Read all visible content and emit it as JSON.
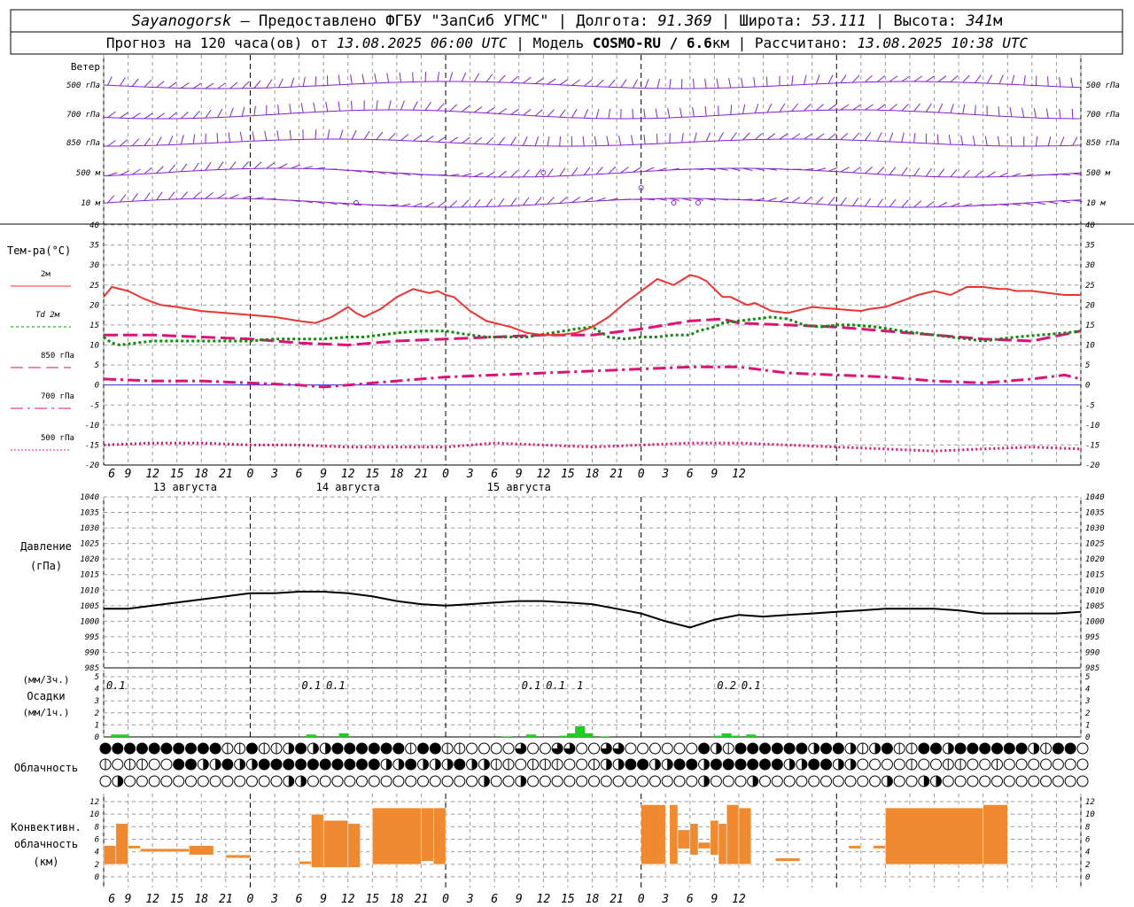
{
  "header": {
    "line1": {
      "station": "Sayanogorsk",
      "provider": " — Предоставлено ФГБУ \"ЗапСиб УГМС\" | Долгота: ",
      "lon": "91.369",
      "lat_label": " | Широта: ",
      "lat": "53.111",
      "alt_label": " | Высота: ",
      "alt": "341",
      "alt_unit": "м"
    },
    "line2": {
      "prefix": "Прогноз на 120 часа(ов) от ",
      "run": "13.08.2025 06:00 UTC",
      "model_label": "  | Модель ",
      "model": "COSMO-RU / 6.6",
      "model_unit": "км",
      "calc_label": " | Рассчитано: ",
      "calc": "13.08.2025 10:38 UTC"
    }
  },
  "colors": {
    "t2m": "#ee3333",
    "td2m": "#118811",
    "t850": "#dd1177",
    "t700": "#dd1177",
    "t500": "#dd1177",
    "zero_line": "#3333cc",
    "wind": "#8822cc",
    "pressure": "#000000",
    "precip": "#22cc22",
    "convective": "#f08a30",
    "grid": "#999999"
  },
  "x_axis": {
    "hour_ticks": [
      "6",
      "9",
      "12",
      "15",
      "18",
      "21",
      "0",
      "3",
      "6",
      "9",
      "12",
      "15",
      "18",
      "21",
      "0",
      "3",
      "6",
      "9",
      "12",
      "15",
      "18",
      "21",
      "0",
      "3",
      "6",
      "9",
      "12"
    ],
    "dates": [
      "13 августа",
      "14 августа",
      "15 августа"
    ]
  },
  "wind_panel": {
    "title": "Ветер",
    "levels_left": [
      "500 гПа",
      "700 гПа",
      "850 гПа",
      "500 м",
      "10 м"
    ],
    "levels_right": [
      "500 гПа",
      "700 гПа",
      "850 гПа",
      "500 м",
      "10 м"
    ]
  },
  "temp_panel": {
    "title": "Тем-ра(°C)",
    "legend": [
      {
        "label": "2м",
        "style": "solid",
        "key": "t2m"
      },
      {
        "label": "Td 2м",
        "style": "dotted",
        "key": "td2m"
      },
      {
        "label": "850 гПа",
        "style": "dashed",
        "key": "t850"
      },
      {
        "label": "700 гПа",
        "style": "dashdot",
        "key": "t700"
      },
      {
        "label": "500 гПа",
        "style": "dotted",
        "key": "t500"
      }
    ],
    "yticks": [
      "40",
      "35",
      "30",
      "25",
      "20",
      "15",
      "10",
      "5",
      "0",
      "-5",
      "-10",
      "-15",
      "-20"
    ]
  },
  "pressure_panel": {
    "title": "Давление",
    "unit": "(гПа)",
    "yticks": [
      "1040",
      "1035",
      "1030",
      "1025",
      "1020",
      "1015",
      "1010",
      "1005",
      "1000",
      "995",
      "990",
      "985"
    ]
  },
  "precip_panel": {
    "title": "Осадки",
    "unit_3h": "(мм/3ч.)",
    "unit_1h": "(мм/1ч.)",
    "yticks": [
      "5",
      "4",
      "3",
      "2",
      "1",
      "0"
    ],
    "labels": [
      {
        "h": 1.5,
        "text": "0.1"
      },
      {
        "h": 25.5,
        "text": "0.1"
      },
      {
        "h": 28.5,
        "text": "0.1"
      },
      {
        "h": 52.5,
        "text": "0.1"
      },
      {
        "h": 55.5,
        "text": "0.1"
      },
      {
        "h": 58.5,
        "text": "1"
      },
      {
        "h": 76.5,
        "text": "0.2"
      },
      {
        "h": 79.5,
        "text": "0.1"
      }
    ]
  },
  "cloud_panel": {
    "title": "Облачность"
  },
  "conv_panel": {
    "title_1": "Конвективн.",
    "title_2": "облачность",
    "unit": "(км)",
    "yticks": [
      "12",
      "10",
      "8",
      "6",
      "4",
      "2",
      "0"
    ]
  },
  "chart_data": [
    {
      "type": "line",
      "title": "Тем-ра(°C)",
      "ylim": [
        -20,
        40
      ],
      "x_unit": "hours since 13.08.2025 06:00 UTC",
      "series": [
        {
          "name": "2м",
          "x": [
            0,
            1,
            3,
            5,
            7,
            9,
            12,
            15,
            18,
            21,
            24,
            26,
            28,
            30,
            31,
            32,
            34,
            36,
            38,
            40,
            41,
            42,
            43,
            45,
            47,
            50,
            52,
            54,
            56,
            58,
            60,
            62,
            64,
            67,
            68,
            70,
            72,
            73,
            74,
            75,
            76,
            77,
            79,
            80,
            82,
            84,
            87,
            90,
            93,
            94,
            96,
            98,
            100,
            102,
            104,
            106,
            108,
            110,
            111,
            112,
            114,
            116,
            118,
            120
          ],
          "y": [
            22,
            24.5,
            23.5,
            21.5,
            20,
            19.5,
            18.5,
            18,
            17.5,
            17,
            16,
            15.5,
            17,
            19.5,
            18,
            17,
            19,
            22,
            24,
            23,
            23.5,
            22.5,
            22,
            18.5,
            16,
            14.5,
            13,
            12.5,
            12.5,
            13,
            14.5,
            17,
            20.5,
            25,
            26.5,
            25,
            27.5,
            27,
            26,
            24,
            22,
            22,
            20,
            20.5,
            18.5,
            18,
            19.5,
            19,
            18.5,
            19,
            19.5,
            21,
            22.5,
            23.5,
            22.5,
            24.5,
            24.5,
            24,
            24,
            23.5,
            23.5,
            23,
            22.5,
            22.5
          ]
        },
        {
          "name": "Td 2м",
          "x": [
            0,
            1,
            2,
            4,
            6,
            9,
            12,
            15,
            18,
            21,
            24,
            27,
            30,
            32,
            34,
            36,
            39,
            42,
            45,
            47,
            48,
            50,
            52,
            55,
            58,
            60,
            62,
            64,
            66,
            68,
            70,
            72,
            73,
            74,
            75,
            76,
            78,
            80,
            82,
            84,
            86,
            88,
            90,
            92,
            95,
            98,
            100,
            102,
            104,
            106,
            108,
            110,
            112,
            115,
            118,
            120
          ],
          "y": [
            12,
            10.5,
            10,
            10.5,
            11,
            11,
            11,
            11,
            11,
            11.5,
            11.5,
            11.5,
            12,
            12,
            12.5,
            13,
            13.5,
            13.5,
            12.5,
            12,
            12,
            12,
            12,
            13,
            14,
            14.5,
            12,
            11.5,
            12,
            12,
            12.5,
            12.5,
            13.5,
            14,
            14.5,
            15.5,
            16,
            16.5,
            17,
            16.5,
            15,
            14.5,
            15,
            15,
            14.5,
            13.5,
            13,
            12.5,
            12,
            11.5,
            11,
            11.5,
            12,
            12.5,
            13,
            13.5
          ]
        },
        {
          "name": "850 гПа",
          "x": [
            0,
            6,
            12,
            18,
            24,
            30,
            36,
            42,
            48,
            54,
            60,
            66,
            72,
            76,
            78,
            84,
            90,
            96,
            102,
            108,
            114,
            120
          ],
          "y": [
            12.5,
            12.5,
            12,
            11.5,
            10.5,
            10,
            11,
            11.5,
            12,
            12.5,
            12.5,
            14,
            16,
            16.5,
            15.5,
            15,
            14.5,
            13.5,
            12.5,
            11.5,
            11,
            13.5
          ]
        },
        {
          "name": "700 гПа",
          "x": [
            0,
            6,
            12,
            18,
            24,
            27,
            30,
            36,
            42,
            48,
            54,
            60,
            66,
            72,
            78,
            84,
            90,
            96,
            102,
            108,
            114,
            118,
            120
          ],
          "y": [
            1.5,
            1,
            1,
            0.5,
            0,
            -0.5,
            0,
            1,
            2,
            2.5,
            3,
            3.5,
            4,
            4.5,
            4.5,
            3,
            2.5,
            2,
            1,
            0.5,
            1.5,
            2.5,
            1.5
          ]
        },
        {
          "name": "500 гПа",
          "x": [
            0,
            6,
            12,
            18,
            24,
            30,
            36,
            42,
            48,
            54,
            60,
            66,
            72,
            78,
            84,
            90,
            96,
            102,
            108,
            114,
            120
          ],
          "y": [
            -15,
            -14.5,
            -14.5,
            -15,
            -15,
            -15.5,
            -15.5,
            -15.5,
            -14.5,
            -15,
            -15.5,
            -15,
            -14.5,
            -14.5,
            -15,
            -15.5,
            -16,
            -16.5,
            -16,
            -15.5,
            -16
          ]
        }
      ]
    },
    {
      "type": "line",
      "title": "Давление",
      "ylabel": "(гПа)",
      "ylim": [
        985,
        1040
      ],
      "x_unit": "hours since 13.08.2025 06:00 UTC",
      "series": [
        {
          "name": "",
          "x": [
            0,
            3,
            6,
            9,
            12,
            15,
            18,
            21,
            24,
            27,
            30,
            33,
            36,
            39,
            42,
            45,
            48,
            51,
            54,
            57,
            60,
            63,
            66,
            69,
            72,
            75,
            78,
            81,
            84,
            87,
            90,
            93,
            96,
            99,
            102,
            105,
            108,
            111,
            114,
            117,
            120
          ],
          "y": [
            1004,
            1004,
            1005,
            1006,
            1007,
            1008,
            1009,
            1009,
            1009.5,
            1009.5,
            1009,
            1008,
            1006.5,
            1005.5,
            1005,
            1005.5,
            1006,
            1006.5,
            1006.5,
            1006,
            1005.5,
            1004,
            1002.5,
            1000,
            998,
            1000.5,
            1002,
            1001.5,
            1002,
            1002.5,
            1003,
            1003.5,
            1004,
            1004,
            1004,
            1003.5,
            1002.5,
            1002.5,
            1002.5,
            1002.5,
            1003
          ]
        }
      ]
    },
    {
      "type": "bar",
      "title": "Осадки",
      "ylabel": "(мм/1ч.)",
      "ylim": [
        0,
        5
      ],
      "x": [
        1,
        2,
        25,
        29,
        49,
        52,
        56,
        57,
        58,
        59,
        61,
        75,
        76,
        77,
        79
      ],
      "values": [
        0.2,
        0.2,
        0.2,
        0.3,
        0.05,
        0.2,
        0.1,
        0.3,
        0.9,
        0.3,
        0.05,
        0.1,
        0.3,
        0.1,
        0.2
      ]
    },
    {
      "type": "bar",
      "title": "Конвективн. облачность",
      "ylabel": "(км)",
      "ylim": [
        0,
        12
      ],
      "segments": [
        {
          "x0": 0,
          "x1": 1.5,
          "bottom": 2,
          "top": 5
        },
        {
          "x0": 1.5,
          "x1": 3,
          "bottom": 2,
          "top": 8.5
        },
        {
          "x0": 3,
          "x1": 4.5,
          "bottom": 4.5,
          "top": 5
        },
        {
          "x0": 4.5,
          "x1": 10.5,
          "bottom": 4,
          "top": 4.5
        },
        {
          "x0": 10.5,
          "x1": 13.5,
          "bottom": 3.5,
          "top": 5
        },
        {
          "x0": 15,
          "x1": 18,
          "bottom": 3,
          "top": 3.5
        },
        {
          "x0": 24,
          "x1": 25.5,
          "bottom": 2,
          "top": 2.5
        },
        {
          "x0": 25.5,
          "x1": 27,
          "bottom": 1.5,
          "top": 10
        },
        {
          "x0": 27,
          "x1": 30,
          "bottom": 1.5,
          "top": 9
        },
        {
          "x0": 30,
          "x1": 31.5,
          "bottom": 1.5,
          "top": 8.5
        },
        {
          "x0": 33,
          "x1": 39,
          "bottom": 2,
          "top": 11
        },
        {
          "x0": 39,
          "x1": 40.5,
          "bottom": 2.5,
          "top": 11
        },
        {
          "x0": 40.5,
          "x1": 42,
          "bottom": 2,
          "top": 11
        },
        {
          "x0": 66,
          "x1": 69,
          "bottom": 2,
          "top": 11.5
        },
        {
          "x0": 69.5,
          "x1": 70.5,
          "bottom": 2,
          "top": 11.5
        },
        {
          "x0": 70.5,
          "x1": 72,
          "bottom": 4.5,
          "top": 7.5
        },
        {
          "x0": 72,
          "x1": 73,
          "bottom": 3.5,
          "top": 8.5
        },
        {
          "x0": 73,
          "x1": 74.5,
          "bottom": 4.5,
          "top": 5.5
        },
        {
          "x0": 74.5,
          "x1": 75.5,
          "bottom": 3.5,
          "top": 9
        },
        {
          "x0": 75.5,
          "x1": 76.5,
          "bottom": 2,
          "top": 8.5
        },
        {
          "x0": 76.5,
          "x1": 78,
          "bottom": 2,
          "top": 11.5
        },
        {
          "x0": 78,
          "x1": 79.5,
          "bottom": 2,
          "top": 11
        },
        {
          "x0": 82.5,
          "x1": 85.5,
          "bottom": 2.5,
          "top": 3
        },
        {
          "x0": 91.5,
          "x1": 93,
          "bottom": 4.5,
          "top": 5
        },
        {
          "x0": 94.5,
          "x1": 96,
          "bottom": 4.5,
          "top": 5
        },
        {
          "x0": 96,
          "x1": 108,
          "bottom": 2,
          "top": 11
        },
        {
          "x0": 108,
          "x1": 111,
          "bottom": 2,
          "top": 11.5
        }
      ]
    }
  ]
}
